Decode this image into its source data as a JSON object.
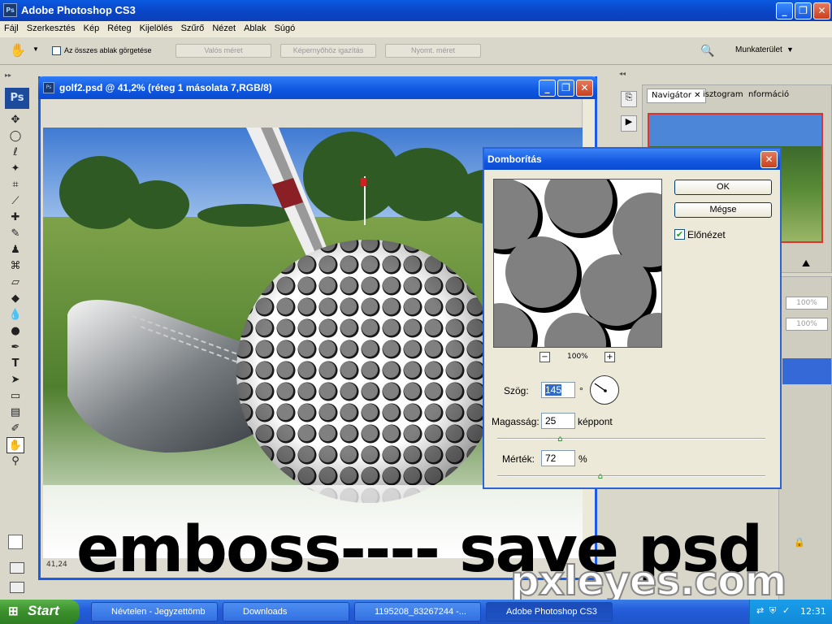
{
  "app": {
    "title": "Adobe Photoshop CS3",
    "icon": "Ps"
  },
  "menu": [
    "Fájl",
    "Szerkesztés",
    "Kép",
    "Réteg",
    "Kijelölés",
    "Szűrő",
    "Nézet",
    "Ablak",
    "Súgó"
  ],
  "options": {
    "scroll_all": "Az összes ablak görgetése",
    "actual_pixels": "Valós méret",
    "fit_screen": "Képernyőhöz igazítás",
    "print_size": "Nyomt. méret",
    "workspace": "Munkaterület"
  },
  "tools": {
    "badge": "Ps"
  },
  "document": {
    "title": "golf2.psd @ 41,2% (réteg 1 másolata 7,RGB/8)",
    "status_zoom": "41,24"
  },
  "panels": {
    "tab_navigator": "Navigátor",
    "tab_histogram": "isztogram",
    "tab_info": "nformáció",
    "zoom_1": "100%",
    "zoom_2": "100%"
  },
  "dialog": {
    "title": "Domborítás",
    "ok": "OK",
    "cancel": "Mégse",
    "preview_label": "Előnézet",
    "preview_checked": true,
    "preview_zoom": "100%",
    "angle_label": "Szög:",
    "angle_value": "145",
    "angle_unit": "°",
    "height_label": "Magasság:",
    "height_value": "25",
    "height_unit": "képpont",
    "height_slider_fraction": 0.24,
    "amount_label": "Mérték:",
    "amount_value": "72",
    "amount_unit": "%",
    "amount_slider_fraction": 0.39
  },
  "overlay": {
    "caption": "emboss---- save psd",
    "watermark": "pxleyes.com"
  },
  "taskbar": {
    "start": "Start",
    "tasks": [
      "Névtelen - Jegyzettömb",
      "Downloads",
      "1195208_83267244 -...",
      "Adobe Photoshop CS3"
    ],
    "clock": "12:31"
  }
}
